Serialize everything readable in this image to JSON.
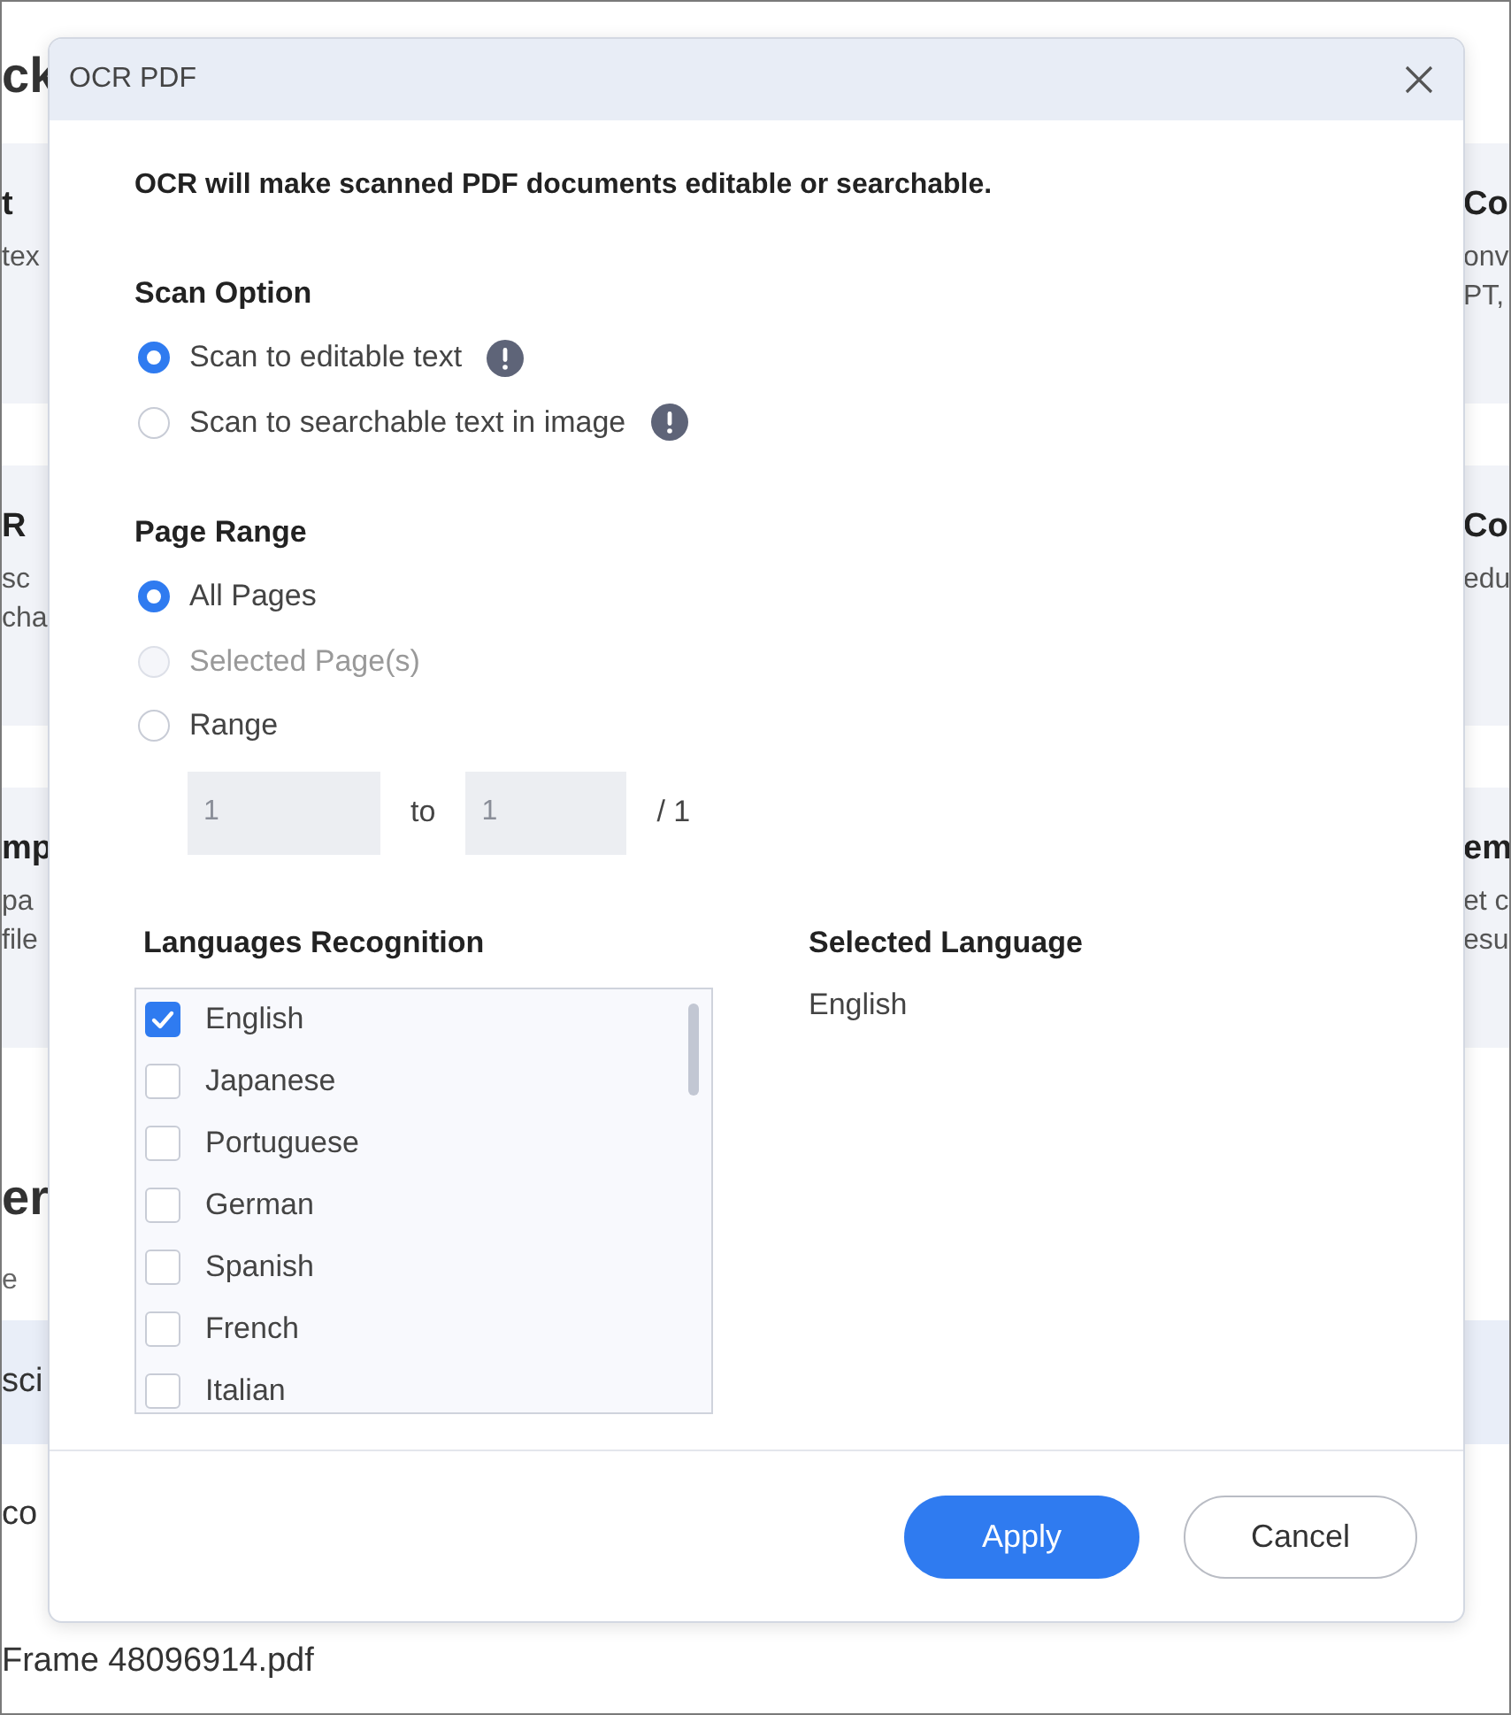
{
  "background": {
    "sections": [
      {
        "kind": "heading",
        "left": [
          "ck"
        ]
      },
      {
        "kind": "card",
        "left": [
          "t",
          "tex"
        ],
        "right": [
          "Co",
          "onv",
          "PT,"
        ]
      },
      {
        "kind": "card",
        "left": [
          "R",
          "sc",
          "cha"
        ],
        "right": [
          "Co",
          "edu"
        ]
      },
      {
        "kind": "card",
        "left": [
          "mp",
          "pa",
          "file"
        ],
        "right": [
          "em",
          "et c",
          "esu"
        ]
      },
      {
        "kind": "heading",
        "left": [
          "er"
        ]
      },
      {
        "kind": "caption",
        "left": [
          "e"
        ]
      },
      {
        "kind": "row",
        "selected": true,
        "left": [
          "sci"
        ]
      },
      {
        "kind": "row",
        "selected": false,
        "left": [
          "co"
        ]
      },
      {
        "kind": "row",
        "selected": false,
        "left": [
          "Frame 48096914.pdf"
        ]
      }
    ]
  },
  "dialog": {
    "title": "OCR PDF",
    "intro": "OCR will make scanned PDF documents editable or searchable.",
    "scan_option": {
      "label": "Scan Option",
      "options": [
        {
          "label": "Scan to editable text",
          "selected": true,
          "info": true
        },
        {
          "label": "Scan to searchable text in image",
          "selected": false,
          "info": true
        }
      ]
    },
    "page_range": {
      "label": "Page Range",
      "options": [
        {
          "label": "All Pages",
          "selected": true,
          "disabled": false
        },
        {
          "label": "Selected Page(s)",
          "selected": false,
          "disabled": true
        },
        {
          "label": "Range",
          "selected": false,
          "disabled": false
        }
      ],
      "from": {
        "placeholder": "1",
        "disabled": true
      },
      "to_label": "to",
      "to": {
        "placeholder": "1",
        "disabled": true
      },
      "total": "/ 1"
    },
    "languages": {
      "label": "Languages Recognition",
      "items": [
        {
          "label": "English",
          "checked": true
        },
        {
          "label": "Japanese",
          "checked": false
        },
        {
          "label": "Portuguese",
          "checked": false
        },
        {
          "label": "German",
          "checked": false
        },
        {
          "label": "Spanish",
          "checked": false
        },
        {
          "label": "French",
          "checked": false
        },
        {
          "label": "Italian",
          "checked": false
        }
      ]
    },
    "selected_language": {
      "label": "Selected Language",
      "value": "English"
    },
    "buttons": [
      {
        "label": "Apply",
        "kind": "primary"
      },
      {
        "label": "Cancel",
        "kind": "secondary"
      }
    ]
  }
}
